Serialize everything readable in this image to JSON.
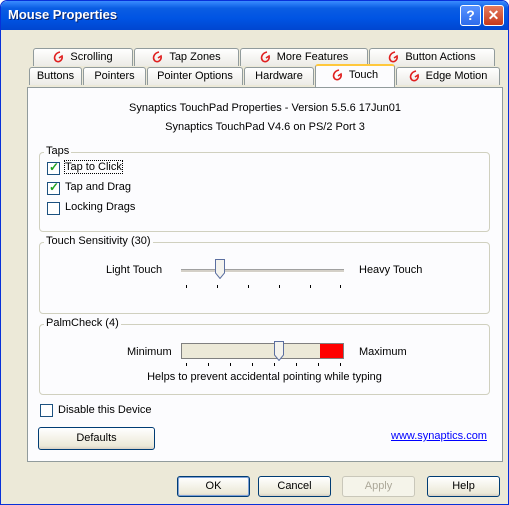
{
  "window": {
    "title": "Mouse Properties",
    "help_glyph": "?",
    "close_glyph": "✕"
  },
  "tabs_back_row": [
    "Scrolling",
    "Tap Zones",
    "More Features",
    "Button Actions"
  ],
  "tabs_front_row": [
    "Buttons",
    "Pointers",
    "Pointer Options",
    "Hardware",
    "Touch",
    "Edge Motion"
  ],
  "active_tab": "Touch",
  "info": {
    "line1": "Synaptics TouchPad Properties - Version 5.5.6 17Jun01",
    "line2": "Synaptics TouchPad V4.6 on PS/2 Port 3"
  },
  "taps": {
    "title": "Taps",
    "options": [
      {
        "label": "Tap to Click",
        "checked": true
      },
      {
        "label": "Tap and Drag",
        "checked": true
      },
      {
        "label": "Locking Drags",
        "checked": false
      }
    ]
  },
  "touch_sensitivity": {
    "title": "Touch Sensitivity (30)",
    "min_label": "Light Touch",
    "max_label": "Heavy Touch",
    "value_fraction": 0.27
  },
  "palmcheck": {
    "title": "PalmCheck (4)",
    "min_label": "Minimum",
    "max_label": "Maximum",
    "value_fraction": 0.57,
    "help_text": "Helps to prevent accidental pointing while typing",
    "warning_color": "#ff0000"
  },
  "disable_device": {
    "label": "Disable this Device",
    "checked": false
  },
  "defaults_label": "Defaults",
  "link_text": "www.synaptics.com",
  "buttons": {
    "ok": "OK",
    "cancel": "Cancel",
    "apply": "Apply",
    "help": "Help"
  },
  "colors": {
    "titlebar": "#0054e3",
    "tab_highlight": "#ffc83c",
    "synaptics_icon": "#e02020"
  }
}
